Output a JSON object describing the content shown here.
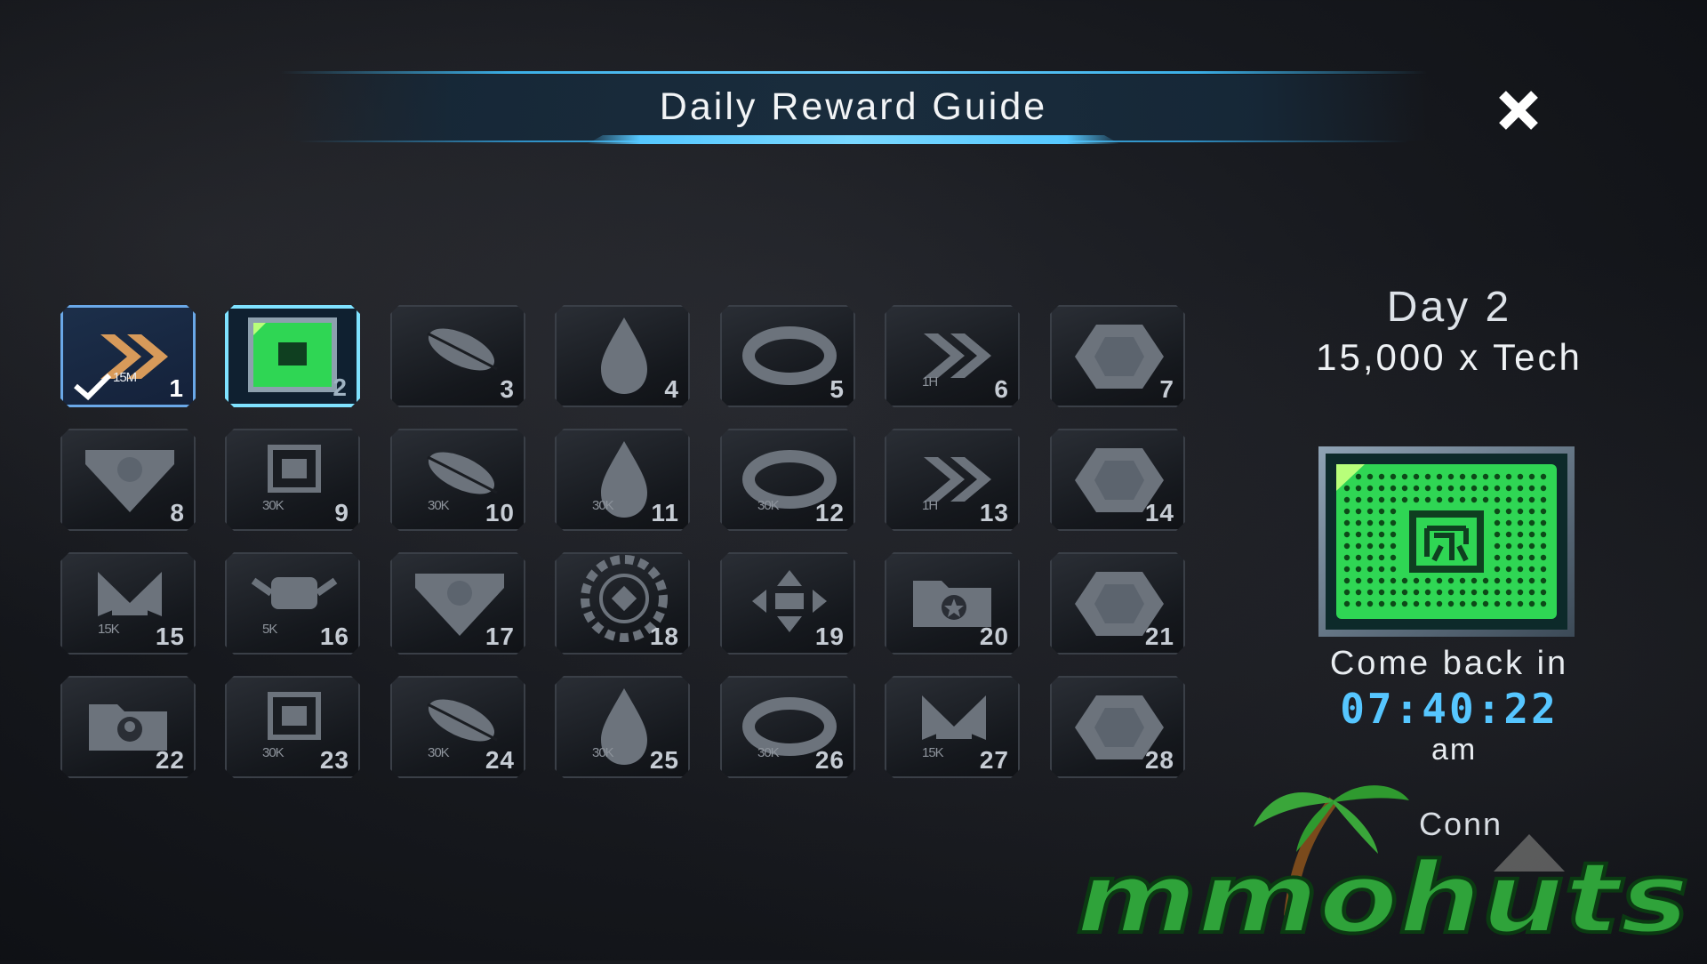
{
  "header": {
    "title": "Daily Reward Guide"
  },
  "close_icon": "close-icon",
  "days": [
    {
      "num": "1",
      "amount": "15M",
      "icon": "speedup-chevron-icon",
      "state": "claimed"
    },
    {
      "num": "2",
      "amount": "",
      "icon": "tech-chip-icon",
      "state": "current"
    },
    {
      "num": "3",
      "amount": "",
      "icon": "corn-food-icon",
      "state": "locked"
    },
    {
      "num": "4",
      "amount": "",
      "icon": "oil-drop-icon",
      "state": "locked"
    },
    {
      "num": "5",
      "amount": "",
      "icon": "metal-ring-icon",
      "state": "locked"
    },
    {
      "num": "6",
      "amount": "1H",
      "icon": "speedup-chevron-icon",
      "state": "locked"
    },
    {
      "num": "7",
      "amount": "",
      "icon": "gem-hexagon-icon",
      "state": "locked"
    },
    {
      "num": "8",
      "amount": "",
      "icon": "shield-badge-icon",
      "state": "locked"
    },
    {
      "num": "9",
      "amount": "30K",
      "icon": "tech-chip-icon",
      "state": "locked"
    },
    {
      "num": "10",
      "amount": "30K",
      "icon": "corn-food-icon",
      "state": "locked"
    },
    {
      "num": "11",
      "amount": "30K",
      "icon": "oil-drop-icon",
      "state": "locked"
    },
    {
      "num": "12",
      "amount": "30K",
      "icon": "metal-ring-icon",
      "state": "locked"
    },
    {
      "num": "13",
      "amount": "1H",
      "icon": "speedup-chevron-icon",
      "state": "locked"
    },
    {
      "num": "14",
      "amount": "",
      "icon": "gem-hexagon-icon",
      "state": "locked"
    },
    {
      "num": "15",
      "amount": "15K",
      "icon": "wings-emblem-icon",
      "state": "locked"
    },
    {
      "num": "16",
      "amount": "5K",
      "icon": "robot-part-icon",
      "state": "locked"
    },
    {
      "num": "17",
      "amount": "",
      "icon": "shield-badge-icon",
      "state": "locked"
    },
    {
      "num": "18",
      "amount": "",
      "icon": "chip-token-icon",
      "state": "locked"
    },
    {
      "num": "19",
      "amount": "",
      "icon": "teleport-arrows-icon",
      "state": "locked"
    },
    {
      "num": "20",
      "amount": "",
      "icon": "star-folder-icon",
      "state": "locked"
    },
    {
      "num": "21",
      "amount": "",
      "icon": "gem-hexagon-icon",
      "state": "locked"
    },
    {
      "num": "22",
      "amount": "",
      "icon": "commander-folder-icon",
      "state": "locked"
    },
    {
      "num": "23",
      "amount": "30K",
      "icon": "tech-chip-icon",
      "state": "locked"
    },
    {
      "num": "24",
      "amount": "30K",
      "icon": "corn-food-icon",
      "state": "locked"
    },
    {
      "num": "25",
      "amount": "30K",
      "icon": "oil-drop-icon",
      "state": "locked"
    },
    {
      "num": "26",
      "amount": "30K",
      "icon": "metal-ring-icon",
      "state": "locked"
    },
    {
      "num": "27",
      "amount": "15K",
      "icon": "wings-emblem-icon",
      "state": "locked"
    },
    {
      "num": "28",
      "amount": "",
      "icon": "gem-hexagon-icon",
      "state": "locked"
    }
  ],
  "panel": {
    "day_label": "Day 2",
    "reward_label": "15,000 x Tech",
    "come_back_label": "Come back in",
    "timer": "07:40:22",
    "ampm": "am",
    "partial_text": "Conn"
  },
  "colors": {
    "accent": "#56c6ff",
    "chip_green": "#2fd654",
    "claimed_border": "#6aa8e8"
  },
  "watermark": {
    "text": "mmohuts"
  }
}
